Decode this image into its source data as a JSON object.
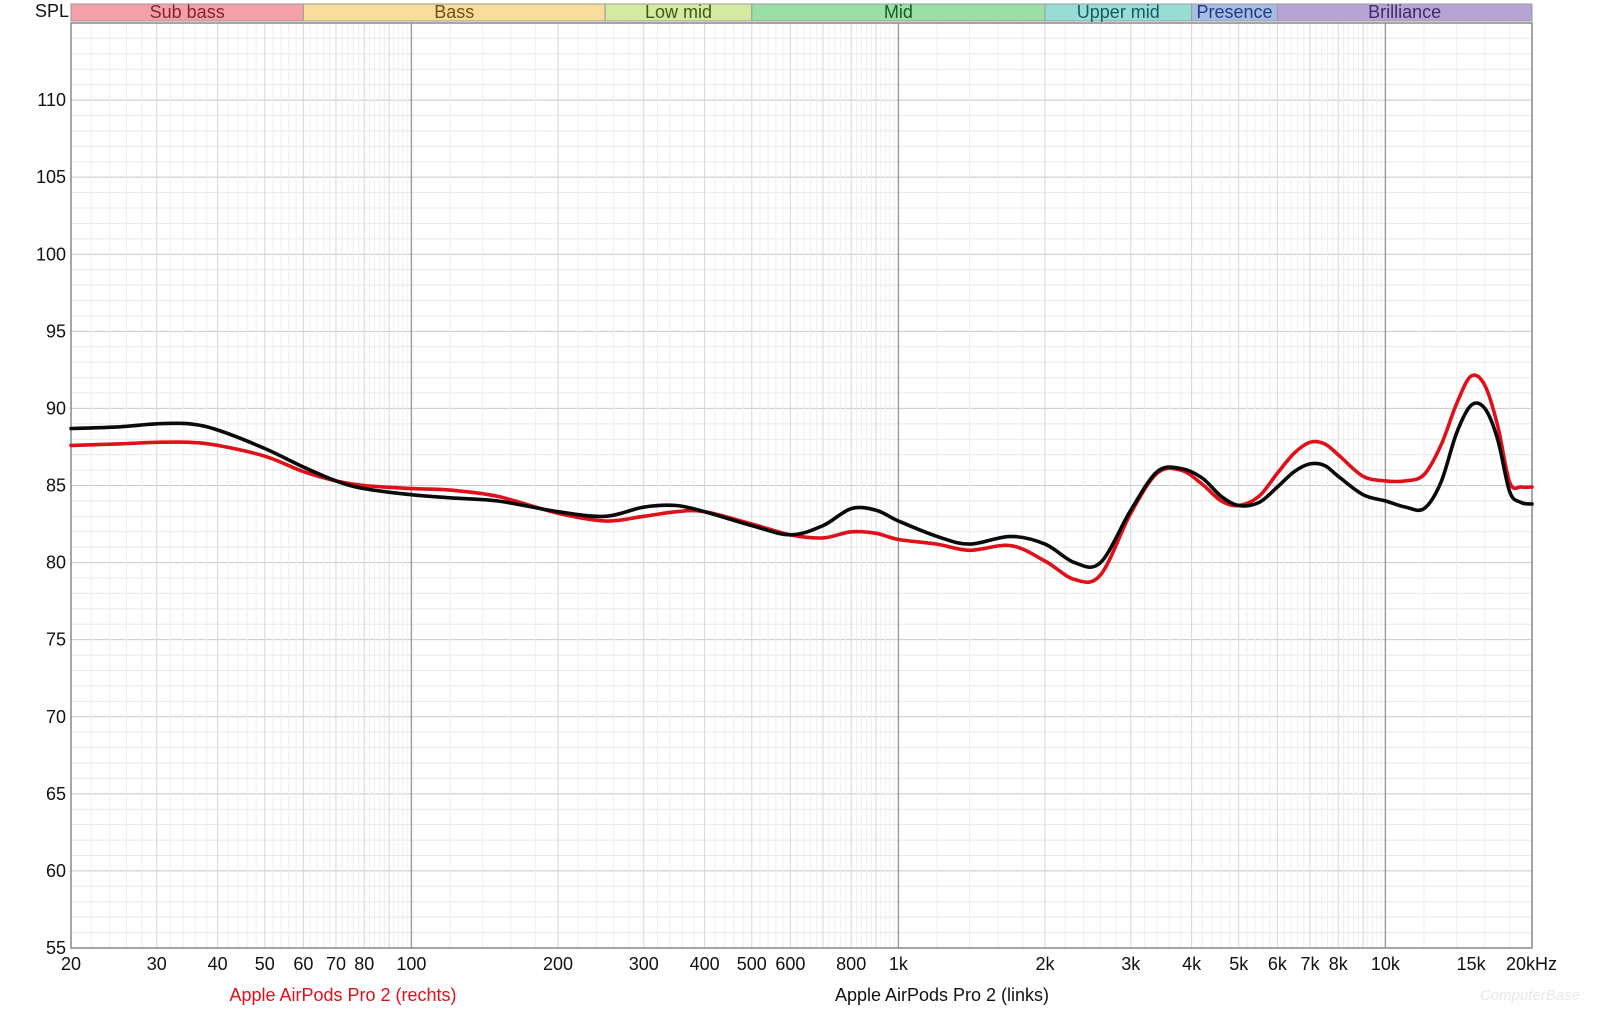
{
  "chart_data": {
    "type": "line",
    "ylabel": "SPL",
    "xlabel": "",
    "x_scale": "log",
    "xlim": [
      20,
      20000
    ],
    "ylim": [
      55,
      115
    ],
    "grid": true,
    "y_ticks": [
      55,
      60,
      65,
      70,
      75,
      80,
      85,
      90,
      95,
      100,
      105,
      110
    ],
    "x_ticks": [
      {
        "value": 20,
        "label": "20"
      },
      {
        "value": 30,
        "label": "30"
      },
      {
        "value": 40,
        "label": "40"
      },
      {
        "value": 50,
        "label": "50"
      },
      {
        "value": 60,
        "label": "60"
      },
      {
        "value": 70,
        "label": "70"
      },
      {
        "value": 80,
        "label": "80"
      },
      {
        "value": 100,
        "label": "100"
      },
      {
        "value": 200,
        "label": "200"
      },
      {
        "value": 300,
        "label": "300"
      },
      {
        "value": 400,
        "label": "400"
      },
      {
        "value": 500,
        "label": "500"
      },
      {
        "value": 600,
        "label": "600"
      },
      {
        "value": 800,
        "label": "800"
      },
      {
        "value": 1000,
        "label": "1k"
      },
      {
        "value": 2000,
        "label": "2k"
      },
      {
        "value": 3000,
        "label": "3k"
      },
      {
        "value": 4000,
        "label": "4k"
      },
      {
        "value": 5000,
        "label": "5k"
      },
      {
        "value": 6000,
        "label": "6k"
      },
      {
        "value": 7000,
        "label": "7k"
      },
      {
        "value": 8000,
        "label": "8k"
      },
      {
        "value": 10000,
        "label": "10k"
      },
      {
        "value": 15000,
        "label": "15k"
      },
      {
        "value": 20000,
        "label": "20kHz"
      }
    ],
    "bands": [
      {
        "name": "Sub bass",
        "from": 20,
        "to": 60,
        "color": "#f4a0a8",
        "text": "#8a2030"
      },
      {
        "name": "Bass",
        "from": 60,
        "to": 250,
        "color": "#f8dc9a",
        "text": "#6e5010"
      },
      {
        "name": "Low mid",
        "from": 250,
        "to": 500,
        "color": "#d4eaa0",
        "text": "#3e5a10"
      },
      {
        "name": "Mid",
        "from": 500,
        "to": 2000,
        "color": "#9adfa6",
        "text": "#175a28"
      },
      {
        "name": "Upper mid",
        "from": 2000,
        "to": 4000,
        "color": "#98dcd6",
        "text": "#145a60"
      },
      {
        "name": "Presence",
        "from": 4000,
        "to": 6000,
        "color": "#a6bce4",
        "text": "#203a80"
      },
      {
        "name": "Brilliance",
        "from": 6000,
        "to": 20000,
        "color": "#b8a4d4",
        "text": "#3e2a6a"
      }
    ],
    "series": [
      {
        "name": "Apple AirPods Pro 2 (rechts)",
        "color": "#e0101a",
        "x": [
          20,
          25,
          30,
          35,
          40,
          50,
          60,
          70,
          80,
          100,
          120,
          150,
          200,
          250,
          300,
          350,
          400,
          500,
          600,
          700,
          800,
          900,
          1000,
          1200,
          1400,
          1700,
          2000,
          2300,
          2600,
          3000,
          3400,
          3800,
          4200,
          4600,
          5000,
          5500,
          6000,
          6500,
          7000,
          7500,
          8000,
          9000,
          10000,
          11000,
          12000,
          13000,
          14000,
          15000,
          16000,
          17000,
          18000,
          19000,
          20000
        ],
        "y": [
          87.6,
          87.7,
          87.8,
          87.8,
          87.6,
          86.9,
          85.9,
          85.3,
          85.0,
          84.8,
          84.7,
          84.3,
          83.2,
          82.7,
          83.0,
          83.3,
          83.3,
          82.5,
          81.8,
          81.6,
          82.0,
          81.9,
          81.5,
          81.2,
          80.8,
          81.1,
          80.1,
          78.9,
          79.2,
          83.2,
          85.8,
          86.0,
          85.1,
          84.0,
          83.7,
          84.3,
          85.8,
          87.1,
          87.8,
          87.7,
          87.0,
          85.6,
          85.3,
          85.3,
          85.7,
          87.6,
          90.3,
          92.1,
          91.5,
          88.9,
          85.2,
          84.9,
          84.9
        ]
      },
      {
        "name": "Apple AirPods Pro 2 (links)",
        "color": "#0a0a0a",
        "x": [
          20,
          25,
          30,
          35,
          40,
          50,
          60,
          70,
          80,
          100,
          120,
          150,
          200,
          250,
          300,
          350,
          400,
          500,
          600,
          700,
          800,
          900,
          1000,
          1200,
          1400,
          1700,
          2000,
          2300,
          2600,
          3000,
          3400,
          3800,
          4200,
          4600,
          5000,
          5500,
          6000,
          6500,
          7000,
          7500,
          8000,
          9000,
          10000,
          11000,
          12000,
          13000,
          14000,
          15000,
          16000,
          17000,
          18000,
          19000,
          20000
        ],
        "y": [
          88.7,
          88.8,
          89.0,
          89.0,
          88.6,
          87.4,
          86.2,
          85.3,
          84.8,
          84.4,
          84.2,
          84.0,
          83.3,
          83.0,
          83.6,
          83.7,
          83.3,
          82.4,
          81.8,
          82.4,
          83.5,
          83.4,
          82.7,
          81.7,
          81.2,
          81.7,
          81.2,
          80.0,
          80.0,
          83.4,
          85.9,
          86.1,
          85.5,
          84.3,
          83.7,
          83.9,
          84.9,
          85.9,
          86.4,
          86.3,
          85.6,
          84.4,
          84.0,
          83.6,
          83.5,
          85.2,
          88.4,
          90.2,
          90.0,
          88.0,
          84.6,
          83.9,
          83.8
        ]
      }
    ]
  },
  "legend": {
    "right_label": "Apple AirPods Pro 2 (rechts)",
    "left_label": "Apple AirPods Pro 2 (links)"
  },
  "watermark": "ComputerBase"
}
